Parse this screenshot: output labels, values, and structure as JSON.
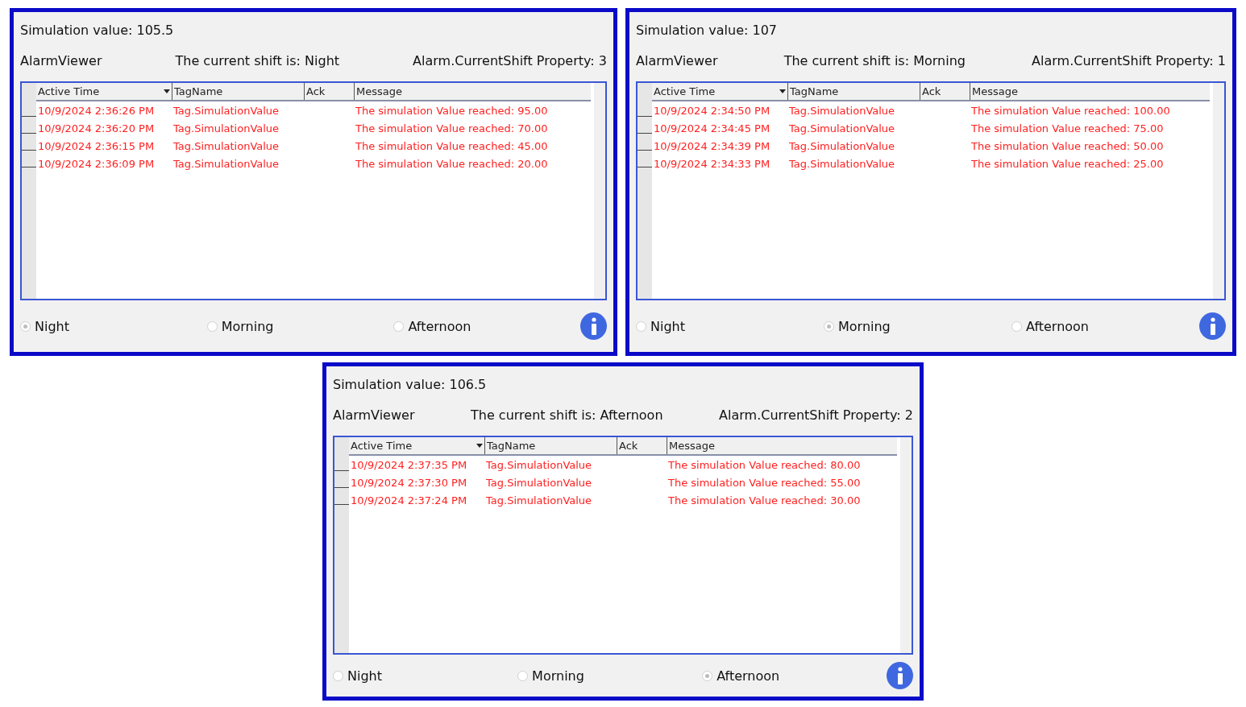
{
  "panels": [
    {
      "simulation": "Simulation value: 105.5",
      "viewer_label": "AlarmViewer",
      "shift_text": "The current shift is: Night",
      "property_text": "Alarm.CurrentShift Property: 3",
      "columns": [
        {
          "label": "Active Time",
          "sorted": true
        },
        {
          "label": "TagName",
          "sorted": false
        },
        {
          "label": "Ack",
          "sorted": false
        },
        {
          "label": "Message",
          "sorted": false
        }
      ],
      "rows": [
        {
          "time": "10/9/2024 2:36:26 PM",
          "tag": "Tag.SimulationValue",
          "message": "The simulation Value reached: 95.00"
        },
        {
          "time": "10/9/2024 2:36:20 PM",
          "tag": "Tag.SimulationValue",
          "message": "The simulation Value reached: 70.00"
        },
        {
          "time": "10/9/2024 2:36:15 PM",
          "tag": "Tag.SimulationValue",
          "message": "The simulation Value reached: 45.00"
        },
        {
          "time": "10/9/2024 2:36:09 PM",
          "tag": "Tag.SimulationValue",
          "message": "The simulation Value reached: 20.00"
        }
      ],
      "shifts": [
        {
          "label": "Night",
          "selected": true
        },
        {
          "label": "Morning",
          "selected": false
        },
        {
          "label": "Afternoon",
          "selected": false
        }
      ]
    },
    {
      "simulation": "Simulation value: 107",
      "viewer_label": "AlarmViewer",
      "shift_text": "The current shift is: Morning",
      "property_text": "Alarm.CurrentShift Property: 1",
      "columns": [
        {
          "label": "Active Time",
          "sorted": true
        },
        {
          "label": "TagName",
          "sorted": false
        },
        {
          "label": "Ack",
          "sorted": false
        },
        {
          "label": "Message",
          "sorted": false
        }
      ],
      "rows": [
        {
          "time": "10/9/2024 2:34:50 PM",
          "tag": "Tag.SimulationValue",
          "message": "The simulation Value reached: 100.00"
        },
        {
          "time": "10/9/2024 2:34:45 PM",
          "tag": "Tag.SimulationValue",
          "message": "The simulation Value reached: 75.00"
        },
        {
          "time": "10/9/2024 2:34:39 PM",
          "tag": "Tag.SimulationValue",
          "message": "The simulation Value reached: 50.00"
        },
        {
          "time": "10/9/2024 2:34:33 PM",
          "tag": "Tag.SimulationValue",
          "message": "The simulation Value reached: 25.00"
        }
      ],
      "shifts": [
        {
          "label": "Night",
          "selected": false
        },
        {
          "label": "Morning",
          "selected": true
        },
        {
          "label": "Afternoon",
          "selected": false
        }
      ]
    },
    {
      "simulation": "Simulation value: 106.5",
      "viewer_label": "AlarmViewer",
      "shift_text": "The current shift is: Afternoon",
      "property_text": "Alarm.CurrentShift Property: 2",
      "columns": [
        {
          "label": "Active Time",
          "sorted": true
        },
        {
          "label": "TagName",
          "sorted": false
        },
        {
          "label": "Ack",
          "sorted": false
        },
        {
          "label": "Message",
          "sorted": false
        }
      ],
      "rows": [
        {
          "time": "10/9/2024 2:37:35 PM",
          "tag": "Tag.SimulationValue",
          "message": "The simulation Value reached: 80.00"
        },
        {
          "time": "10/9/2024 2:37:30 PM",
          "tag": "Tag.SimulationValue",
          "message": "The simulation Value reached: 55.00"
        },
        {
          "time": "10/9/2024 2:37:24 PM",
          "tag": "Tag.SimulationValue",
          "message": "The simulation Value reached: 30.00"
        }
      ],
      "shifts": [
        {
          "label": "Night",
          "selected": false
        },
        {
          "label": "Morning",
          "selected": false
        },
        {
          "label": "Afternoon",
          "selected": true
        }
      ]
    }
  ]
}
